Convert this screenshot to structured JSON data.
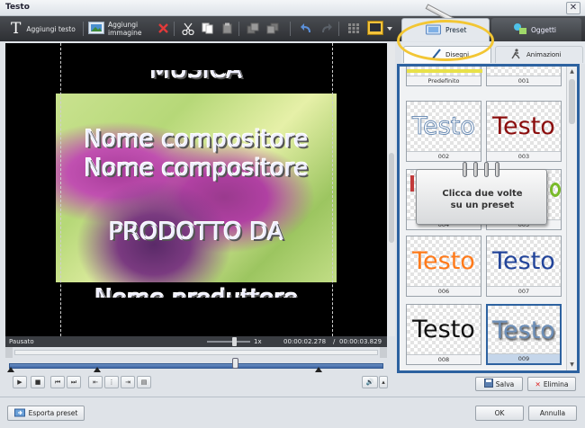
{
  "window": {
    "title": "Testo",
    "close_glyph": "✕"
  },
  "toolbar": {
    "add_text_label": "Aggiungi testo",
    "add_image_label_1": "Aggiungi",
    "add_image_label_2": "immagine"
  },
  "tabs": {
    "preset": "Preset",
    "objects": "Oggetti"
  },
  "subtabs": {
    "drawings": "Disegni",
    "animations": "Animazioni"
  },
  "preview": {
    "line_music": "MUSICA",
    "line_composer_1": "Nome compositore",
    "line_composer_2": "Nome compositore",
    "line_produced_by": "PRODOTTO DA",
    "line_producer": "Nome produttore"
  },
  "status": {
    "state": "Pausato",
    "speed": "1x",
    "current_time": "00:00:02.278",
    "separator": "/",
    "total_time": "00:00:03.829"
  },
  "presets": [
    {
      "label": "Predefinito",
      "sample": "",
      "color": "#222222"
    },
    {
      "label": "001",
      "sample": "",
      "color": "#222222"
    },
    {
      "label": "002",
      "sample": "Testo",
      "color": "#ffffff"
    },
    {
      "label": "003",
      "sample": "Testo",
      "color": "#8b0d0d"
    },
    {
      "label": "004",
      "sample": "",
      "color": "#222222"
    },
    {
      "label": "005",
      "sample": "",
      "color": "#222222"
    },
    {
      "label": "006",
      "sample": "Testo",
      "color": "#ff7a1a"
    },
    {
      "label": "007",
      "sample": "Testo",
      "color": "#22449a"
    },
    {
      "label": "008",
      "sample": "Testo",
      "color": "#111111"
    },
    {
      "label": "009",
      "sample": "Testo",
      "color": "#6d8fb8"
    }
  ],
  "callout": {
    "line1": "Clicca due volte",
    "line2": "su un preset"
  },
  "preset_actions": {
    "save": "Salva",
    "delete": "Elimina"
  },
  "footer": {
    "export": "Esporta preset",
    "ok": "OK",
    "cancel": "Annulla"
  },
  "colors": {
    "accent_frame": "#2d62a0",
    "highlight_ring": "#f2c634",
    "selected_cell": "#2d62a0"
  }
}
